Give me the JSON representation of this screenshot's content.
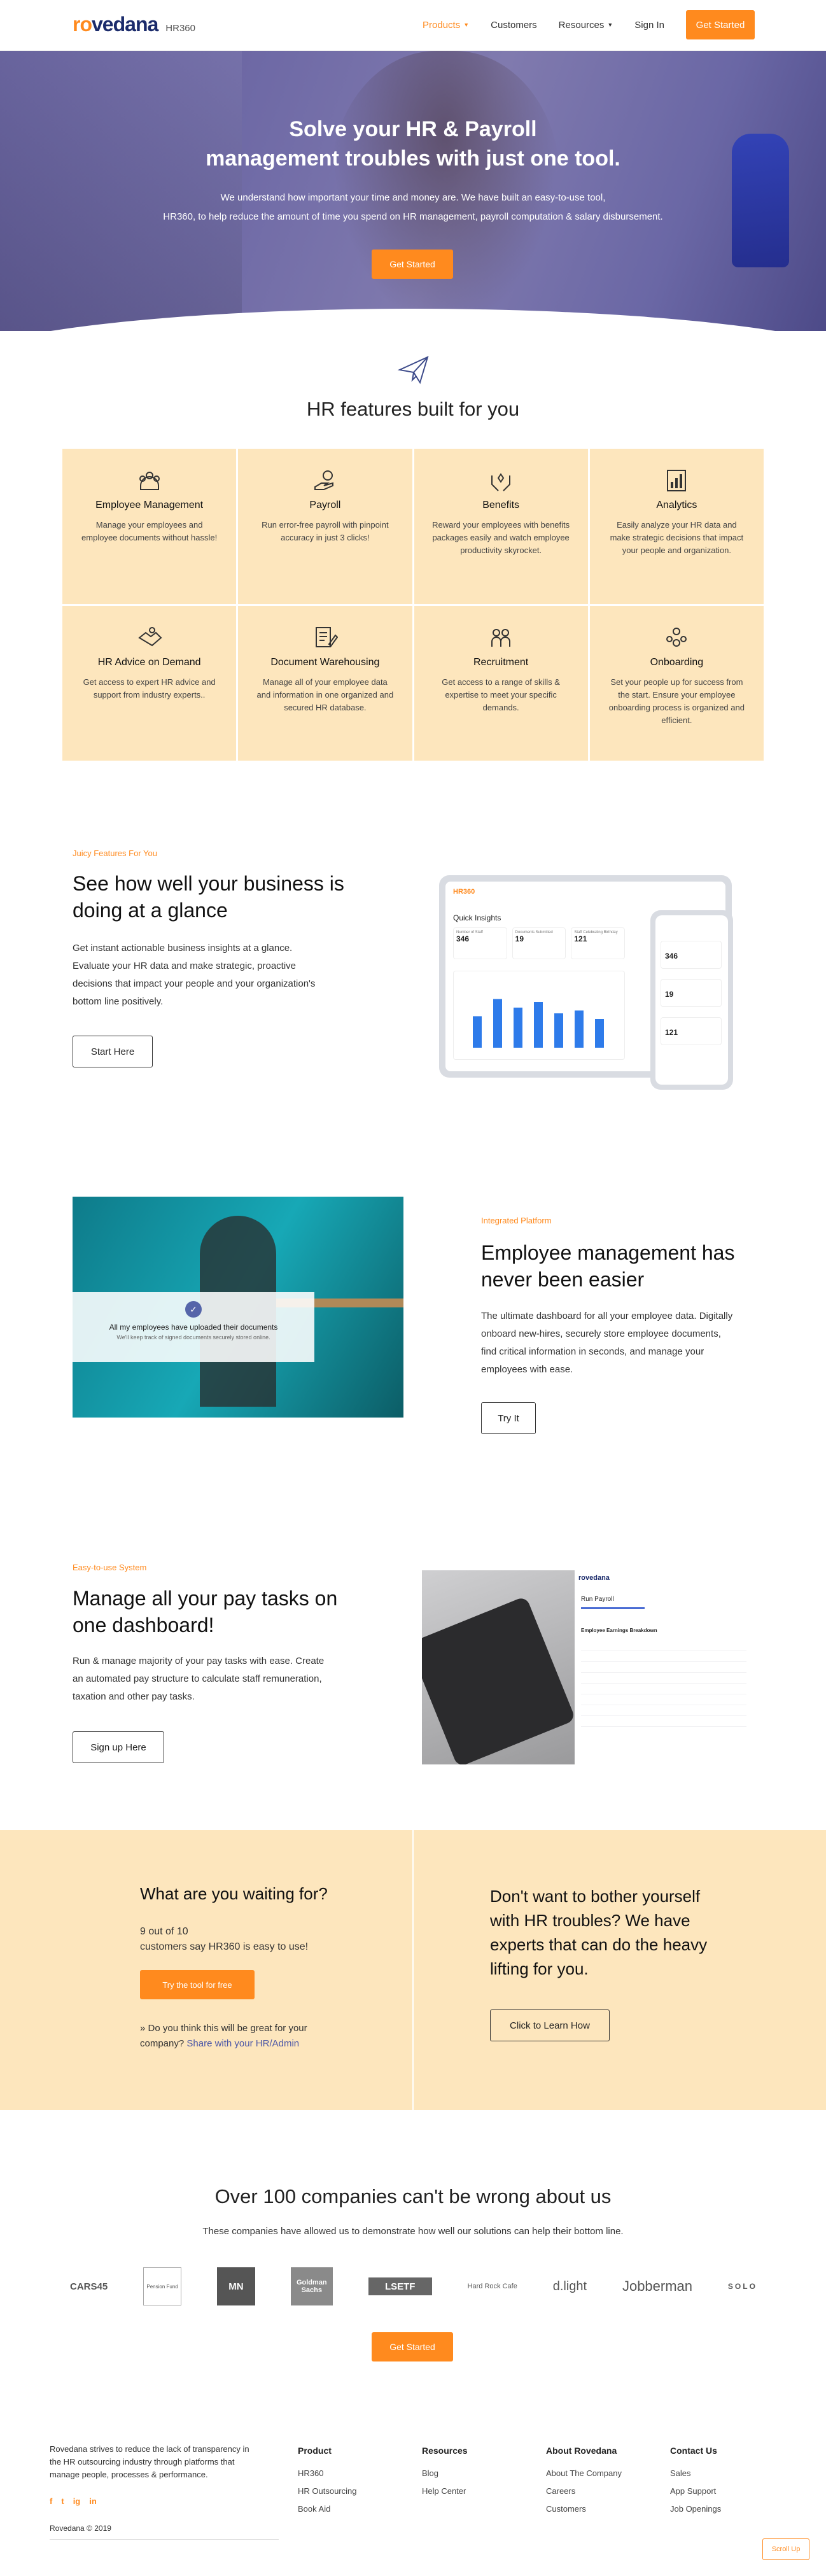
{
  "nav": {
    "logo_part1": "ro",
    "logo_part2": "vedana",
    "logo_suffix": "HR360",
    "items": [
      "Products",
      "Customers",
      "Resources",
      "Sign In"
    ],
    "cta": "Get Started"
  },
  "hero": {
    "title_line1": "Solve your HR & Payroll",
    "title_line2": "management troubles with just one tool.",
    "sub_line1": "We understand how important your time and money are. We have built an easy-to-use tool,",
    "sub_line2": "HR360, to help reduce the amount of time you spend on HR management, payroll computation & salary disbursement.",
    "cta": "Get Started"
  },
  "features": {
    "title": "HR features built for you",
    "items": [
      {
        "icon": "team-icon",
        "title": "Employee Management",
        "desc": "Manage your employees and employee documents without hassle!"
      },
      {
        "icon": "payroll-hand-icon",
        "title": "Payroll",
        "desc": "Run error-free payroll with pinpoint accuracy in just 3 clicks!"
      },
      {
        "icon": "benefits-hands-icon",
        "title": "Benefits",
        "desc": "Reward your employees with benefits packages easily and watch employee productivity skyrocket."
      },
      {
        "icon": "analytics-chart-icon",
        "title": "Analytics",
        "desc": "Easily analyze your HR data and make strategic decisions that impact your people and organization."
      },
      {
        "icon": "advice-handshake-icon",
        "title": "HR Advice on Demand",
        "desc": "Get access to expert HR advice and support from industry experts.."
      },
      {
        "icon": "document-edit-icon",
        "title": "Document Warehousing",
        "desc": "Manage all of your employee data and information in one organized and secured HR database."
      },
      {
        "icon": "recruitment-people-icon",
        "title": "Recruitment",
        "desc": "Get access to a range of skills & expertise to meet your specific demands."
      },
      {
        "icon": "onboarding-group-icon",
        "title": "Onboarding",
        "desc": "Set your people up for success from the start. Ensure your employee onboarding process is organized and efficient."
      }
    ]
  },
  "insights": {
    "eyebrow": "Juicy Features For You",
    "title_line1": "See how well your business is",
    "title_line2": "doing at a glance",
    "body": [
      "Get instant actionable business insights at a glance.",
      "Evaluate your HR data and make strategic, proactive",
      "decisions that impact your people and your organization's",
      "bottom line positively."
    ],
    "cta": "Start Here",
    "mock": {
      "brand": "HR360",
      "heading": "Quick Insights",
      "stats": [
        {
          "label": "Number of Staff",
          "value": "346"
        },
        {
          "label": "Documents Submitted",
          "value": "19"
        },
        {
          "label": "Staff Celebrating Birthday",
          "value": "121"
        }
      ],
      "bars": [
        0.55,
        0.85,
        0.7,
        0.8,
        0.6,
        0.65,
        0.5
      ]
    }
  },
  "employee": {
    "eyebrow": "Integrated Platform",
    "title_line1": "Employee management has",
    "title_line2": "never been easier",
    "body": [
      "The ultimate dashboard for all your employee data. Digitally",
      "onboard new-hires, securely store employee documents,",
      "find critical information in seconds, and manage your",
      "employees with ease."
    ],
    "cta": "Try It",
    "photo_caption": "All my employees have uploaded their documents",
    "photo_sub": "We'll keep track of signed documents securely stored online."
  },
  "pay": {
    "eyebrow": "Easy-to-use System",
    "title_line1": "Manage all your pay tasks on",
    "title_line2": "one dashboard!",
    "body": [
      "Run & manage majority of your pay tasks with ease. Create",
      "an automated pay structure to calculate staff remuneration,",
      "taxation and other pay tasks."
    ],
    "cta": "Sign up Here",
    "mock_brand": "rovedana",
    "mock_title": "Run Payroll",
    "mock_section": "Employee Earnings Breakdown"
  },
  "band": {
    "left_title": "What are you waiting for?",
    "left_stat_line1": "9 out of 10",
    "left_stat_line2": "customers say HR360 is easy to use!",
    "left_cta": "Try the tool for free",
    "left_note": "Do you think this will be great for your",
    "left_note2": "company?",
    "left_link": "Share with your HR/Admin",
    "right_title_lines": [
      "Don't want to bother yourself",
      "with HR troubles? We have",
      "experts that can do the heavy",
      "lifting for you."
    ],
    "right_cta": "Click to Learn How"
  },
  "clients": {
    "title": "Over 100 companies can't be wrong about us",
    "subtitle": "These companies have allowed us to demonstrate how well our solutions can help their bottom line.",
    "logos": [
      "CARS45",
      "Pension Fund",
      "MN",
      "Goldman Sachs",
      "LSETF",
      "Hard Rock Cafe",
      "d.light",
      "Jobberman",
      "SOLO"
    ],
    "cta": "Get Started"
  },
  "footer": {
    "about_lines": [
      "Rovedana strives to reduce the lack of transparency in",
      "the HR outsourcing industry through platforms that",
      "manage people, processes & performance."
    ],
    "social": [
      "f",
      "t",
      "ig",
      "in"
    ],
    "copyright": "Rovedana © 2019",
    "columns": [
      {
        "title": "Product",
        "links": [
          "HR360",
          "HR Outsourcing",
          "Book Aid"
        ]
      },
      {
        "title": "Resources",
        "links": [
          "Blog",
          "Help Center"
        ]
      },
      {
        "title": "About Rovedana",
        "links": [
          "About The Company",
          "Careers",
          "Customers"
        ]
      },
      {
        "title": "Contact Us",
        "links": [
          "Sales",
          "App Support",
          "Job Openings"
        ]
      }
    ],
    "scroll_up": "Scroll Up"
  },
  "colors": {
    "accent": "#ff8a1e",
    "navy": "#1b2b6b",
    "cream": "#fde6bd"
  }
}
